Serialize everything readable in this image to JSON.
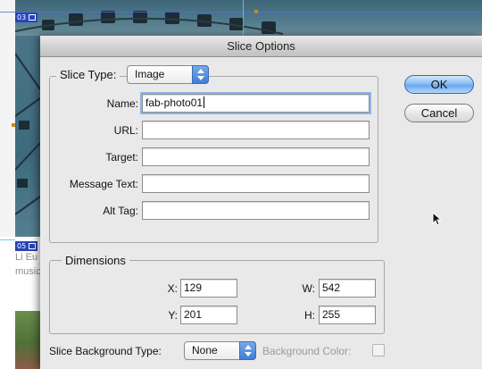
{
  "background": {
    "slice_top_tag": "03",
    "slice_side_tag": "05",
    "text_lines": [
      "Li Eu",
      "music"
    ]
  },
  "dialog": {
    "title": "Slice Options",
    "slice_type": {
      "label": "Slice Type:",
      "value": "Image"
    },
    "fields": [
      {
        "label": "Name:",
        "value": "fab-photo01"
      },
      {
        "label": "URL:",
        "value": ""
      },
      {
        "label": "Target:",
        "value": ""
      },
      {
        "label": "Message Text:",
        "value": ""
      },
      {
        "label": "Alt Tag:",
        "value": ""
      }
    ],
    "dimensions": {
      "title": "Dimensions",
      "x_label": "X:",
      "x": "129",
      "y_label": "Y:",
      "y": "201",
      "w_label": "W:",
      "w": "542",
      "h_label": "H:",
      "h": "255"
    },
    "background_type": {
      "label": "Slice Background Type:",
      "value": "None"
    },
    "background_color_label": "Background Color:",
    "ok_label": "OK",
    "cancel_label": "Cancel"
  },
  "colors": {
    "dialog_bg": "#e9e9e9",
    "default_button": "#6aa8ee",
    "slice_tag": "#2a44b8"
  },
  "icons": {
    "cursor": "arrow-pointer-icon",
    "popup_arrows": "up-down-arrows-icon"
  }
}
